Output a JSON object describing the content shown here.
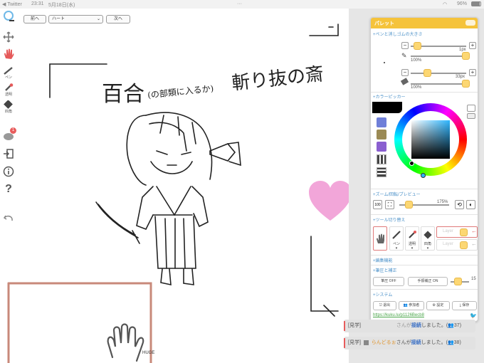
{
  "status_bar": {
    "back_app": "◀ Twitter",
    "time": "23:31",
    "date": "5月18日(水)",
    "dots": "···",
    "battery": "96%"
  },
  "toolbar": {
    "prev_label": "前へ",
    "select_value": "ハート",
    "next_label": "次へ"
  },
  "sidebar": {
    "pen_label": "ペン",
    "eraser_label": "透明",
    "square_label": "四角",
    "chat_badge": "1"
  },
  "palette": {
    "title": "パレット",
    "pen_size_section": "+ペンと消しゴムの大きさ",
    "pen_px": "1px",
    "pen_opacity": "100%",
    "eraser_px": "33px",
    "eraser_opacity": "100%",
    "color_picker_section": "+カラーピッカー",
    "zoom_section": "+ズーム/回転/プレビュー",
    "zoom_reset": "100",
    "zoom_value": "175%",
    "tool_switch_section": "+ツール切り替え",
    "tool_pen": "ペン",
    "tool_eraser": "透明",
    "tool_square": "四角",
    "layer_label": "Layer",
    "edit_section": "+編集機能",
    "pressure_section": "+筆圧と補正",
    "pressure_btn": "筆圧 OFF",
    "stabilizer_btn": "手振補正 ON",
    "stabilizer_value": "15",
    "system_section": "+システム",
    "exit_btn": "退出",
    "participants_btn": "参加者",
    "settings_btn": "設定",
    "save_btn": "保存",
    "url": "https://kuku.lu/p1126Becb8",
    "colors": {
      "accent": "#f5c33b",
      "swatch1": "#6f7fd8",
      "swatch2": "#9b8a55",
      "swatch3": "#8a5fd0",
      "main": "#000000"
    }
  },
  "canvas": {
    "huge_label": "HUGE",
    "title_text_1": "百合",
    "title_text_2": "(の部類に入るか)",
    "title_text_3": "斬り抜の斎"
  },
  "chat": [
    {
      "prefix": "[見学]",
      "user": "",
      "message": "さんが",
      "keyword": "接続",
      "tail": "しました。(",
      "count": "37)"
    },
    {
      "prefix": "[見学]",
      "user": "らんどるぉ",
      "message": "さんが",
      "keyword": "接続",
      "tail": "しました。(",
      "count": "38)"
    }
  ]
}
